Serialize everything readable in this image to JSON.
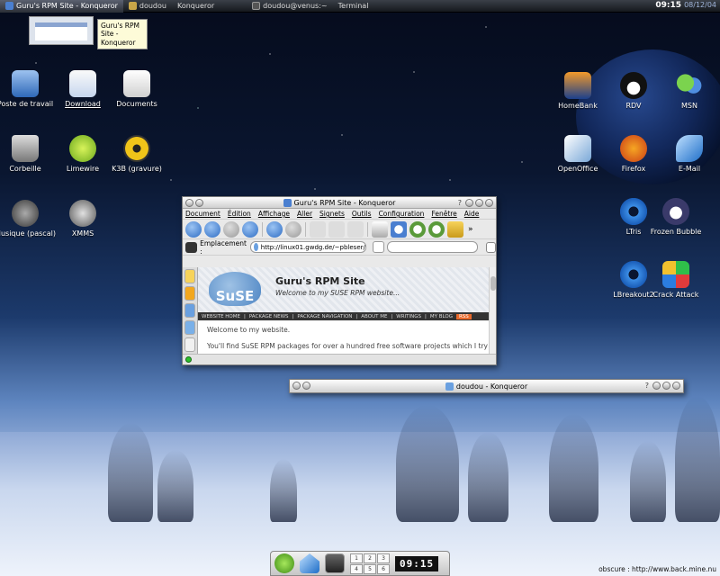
{
  "colors": {
    "accent": "#4f86c4",
    "status_green": "#2cc02c"
  },
  "top_taskbar": {
    "tasks": [
      {
        "label": "Guru's RPM Site - Konqueror",
        "icon": "konqueror-icon",
        "active": true
      },
      {
        "label": "doudou",
        "icon": "folder-icon",
        "active": false
      },
      {
        "label": "Konqueror",
        "icon": "",
        "active": false
      },
      {
        "label": "doudou@venus:~",
        "icon": "terminal-icon",
        "active": false
      },
      {
        "label": "Terminal",
        "icon": "",
        "active": false
      }
    ],
    "clock": "09:15",
    "date": "08/12/04"
  },
  "tooltip": {
    "text": "Guru's RPM Site - Konqueror"
  },
  "desktop_icons_left": [
    {
      "label": "Poste de travail",
      "icon": "computer-icon"
    },
    {
      "label": "Download",
      "icon": "download-folder-icon"
    },
    {
      "label": "Documents",
      "icon": "documents-icon"
    },
    {
      "label": "Corbeille",
      "icon": "trash-icon"
    },
    {
      "label": "Limewire",
      "icon": "limewire-icon"
    },
    {
      "label": "K3B (gravure)",
      "icon": "burn-icon"
    },
    {
      "label": "Musique (pascal)",
      "icon": "music-icon"
    },
    {
      "label": "XMMS",
      "icon": "xmms-icon"
    }
  ],
  "desktop_icons_right": [
    {
      "label": "HomeBank",
      "icon": "homebank-icon"
    },
    {
      "label": "RDV",
      "icon": "penguin-icon"
    },
    {
      "label": "MSN",
      "icon": "msn-icon"
    },
    {
      "label": "OpenOffice",
      "icon": "openoffice-icon"
    },
    {
      "label": "Firefox",
      "icon": "firefox-icon"
    },
    {
      "label": "E-Mail",
      "icon": "email-icon"
    },
    {
      "label": "LTris",
      "icon": "gear-icon"
    },
    {
      "label": "Frozen Bubble",
      "icon": "penguin-icon"
    },
    {
      "label": "LBreakout2",
      "icon": "gear-icon"
    },
    {
      "label": "Crack Attack",
      "icon": "blocks-icon"
    }
  ],
  "konqueror_window": {
    "title": "Guru's RPM Site - Konqueror",
    "menu": [
      "Document",
      "Édition",
      "Affichage",
      "Aller",
      "Signets",
      "Outils",
      "Configuration",
      "Fenêtre",
      "Aide"
    ],
    "location_label": "Emplacement :",
    "url": "http://linux01.gwdg.de/~pbleser/",
    "search_value": "",
    "site": {
      "logo_text": "SuSE",
      "title": "Guru's RPM Site",
      "subtitle": "Welcome to my SUSE RPM website...",
      "nav": [
        "WEBSITE HOME",
        "PACKAGE NEWS",
        "PACKAGE NAVIGATION",
        "ABOUT ME",
        "WRITINGS",
        "MY BLOG"
      ],
      "rss": "RSS",
      "paragraphs": [
        "Welcome to my website.",
        "You'll find SuSE RPM packages for over a hundred free software projects which I try"
      ]
    }
  },
  "file_window": {
    "title": "doudou - Konqueror"
  },
  "bottom_panel": {
    "pager": [
      "1",
      "2",
      "3",
      "4",
      "5",
      "6"
    ],
    "clock": "09:15"
  },
  "footer": {
    "text": "obscure : http://www.back.mine.nu"
  }
}
